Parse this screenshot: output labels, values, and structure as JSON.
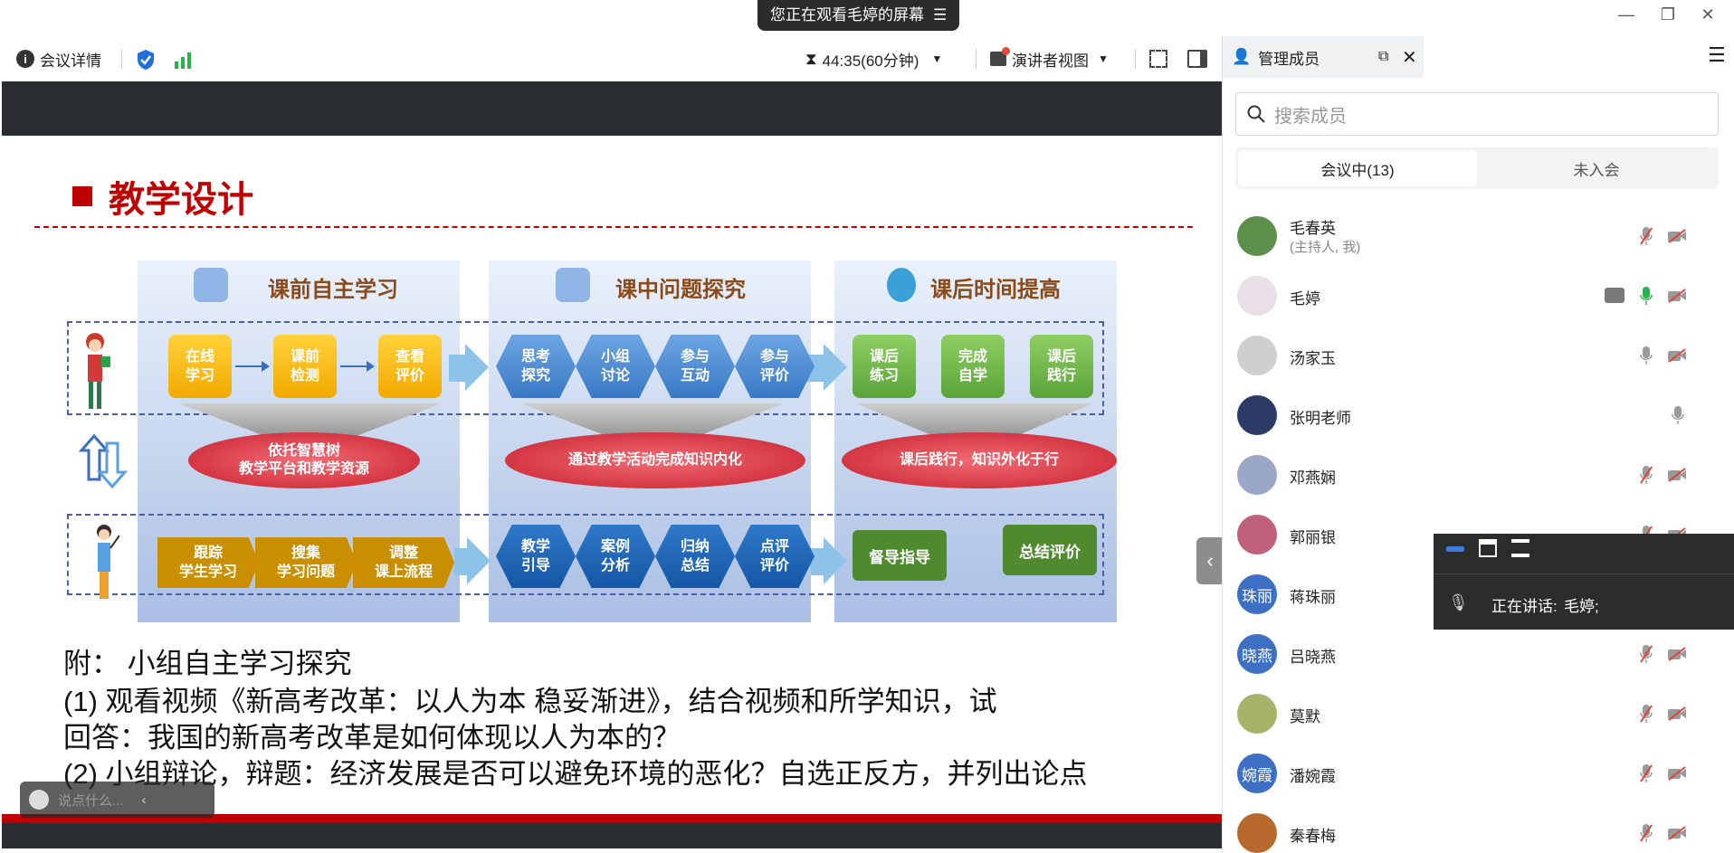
{
  "window": {
    "share_banner": "您正在观看毛婷的屏幕",
    "minimize": "—",
    "restore": "❐",
    "close": "✕"
  },
  "toolbar": {
    "meeting_details": "会议详情",
    "timer": "44:35(60分钟)",
    "presenter_view": "演讲者视图"
  },
  "slide": {
    "title": "教学设计",
    "col1_title": "课前自主学习",
    "col2_title": "课中问题探究",
    "col3_title": "课后时间提高",
    "student_steps": [
      "在线\n学习",
      "课前\n检测",
      "查看\n评价"
    ],
    "inclass_student": [
      "思考\n探究",
      "小组\n讨论",
      "参与\n互动",
      "参与\n评价"
    ],
    "after_student": [
      "课后\n练习",
      "完成\n自学",
      "课后\n践行"
    ],
    "ellipse1": "依托智慧树\n教学平台和教学资源",
    "ellipse2": "通过教学活动完成知识内化",
    "ellipse3": "课后践行，知识外化于行",
    "teacher_steps": [
      "跟踪\n学生学习",
      "搜集\n学习问题",
      "调整\n课上流程"
    ],
    "inclass_teacher": [
      "教学\n引导",
      "案例\n分析",
      "归纳\n总结",
      "点评\n评价"
    ],
    "after_teacher": [
      "督导指导",
      "总结评价"
    ],
    "appendix_title": "附： 小组自主学习探究",
    "appendix_1a": "(1) 观看视频《新高考改革：以人为本 稳妥渐进》，结合视频和所学知识，试",
    "appendix_1b": "回答：我国的新高考改革是如何体现以人为本的？",
    "appendix_2": "(2) 小组辩论，辩题：经济发展是否可以避免环境的恶化？自选正反方，并列出论点"
  },
  "chat": {
    "placeholder": "说点什么..."
  },
  "panel": {
    "title": "管理成员",
    "search_placeholder": "搜索成员",
    "tab_in_meeting": "会议中(13)",
    "tab_not_joined": "未入会",
    "members": [
      {
        "name": "毛春英",
        "sub": "(主持人, 我)",
        "avatar": "",
        "avatar_color": "#5b8f4a",
        "mic": "muted",
        "cam": "off"
      },
      {
        "name": "毛婷",
        "sub": "",
        "avatar": "",
        "avatar_color": "#e9dfe6",
        "mic": "on",
        "cam": "off",
        "sharing": true
      },
      {
        "name": "汤家玉",
        "sub": "",
        "avatar": "",
        "avatar_color": "#cfcfcf",
        "mic": "idle",
        "cam": "off"
      },
      {
        "name": "张明老师",
        "sub": "",
        "avatar": "",
        "avatar_color": "#2c3a66",
        "mic": "idle",
        "cam": "none"
      },
      {
        "name": "邓燕娴",
        "sub": "",
        "avatar": "",
        "avatar_color": "#9aa7c7",
        "mic": "muted",
        "cam": "off"
      },
      {
        "name": "郭丽银",
        "sub": "",
        "avatar": "",
        "avatar_color": "#c0607a",
        "mic": "muted",
        "cam": "off"
      },
      {
        "name": "蒋珠丽",
        "sub": "",
        "avatar": "珠丽",
        "avatar_color": "#3d6fc4",
        "mic": "none",
        "cam": "none"
      },
      {
        "name": "吕晓燕",
        "sub": "",
        "avatar": "晓燕",
        "avatar_color": "#3d6fc4",
        "mic": "muted",
        "cam": "off"
      },
      {
        "name": "莫默",
        "sub": "",
        "avatar": "",
        "avatar_color": "#a8b36a",
        "mic": "muted",
        "cam": "off"
      },
      {
        "name": "潘婉霞",
        "sub": "",
        "avatar": "婉霞",
        "avatar_color": "#3d6fc4",
        "mic": "muted",
        "cam": "off"
      },
      {
        "name": "秦春梅",
        "sub": "",
        "avatar": "",
        "avatar_color": "#b86a2e",
        "mic": "muted",
        "cam": "off"
      }
    ]
  },
  "speaking": {
    "label": "正在讲话:",
    "name": "毛婷;"
  }
}
